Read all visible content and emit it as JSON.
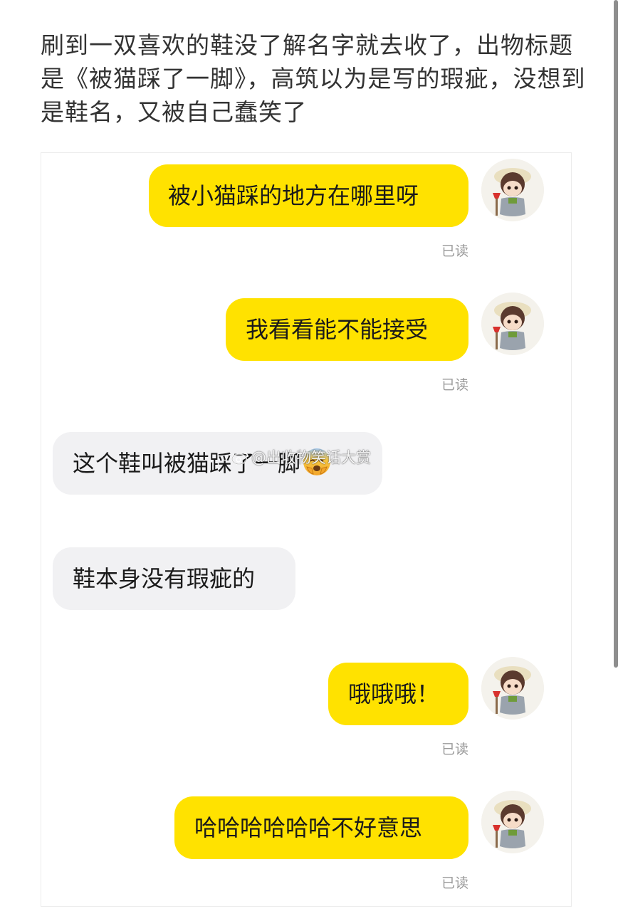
{
  "post": {
    "text": "刷到一双喜欢的鞋没了解名字就去收了，出物标题是《被猫踩了一脚》，高筑以为是写的瑕疵，没想到是鞋名，又被自己蠢笑了"
  },
  "chat": {
    "messages": [
      {
        "text": "被小猫踩的地方在哪里呀",
        "status": "已读"
      },
      {
        "text": "我看看能不能接受",
        "status": "已读"
      },
      {
        "text": "这个鞋叫被猫踩了一脚"
      },
      {
        "text": "鞋本身没有瑕疵的"
      },
      {
        "text": "哦哦哦！",
        "status": "已读"
      },
      {
        "text": "哈哈哈哈哈哈不好意思",
        "status": "已读"
      }
    ],
    "emoji": "cold-sweat-emoji"
  },
  "watermark": {
    "text": "@出收物笑话大赏"
  },
  "colors": {
    "outgoing_bubble": "#ffe200",
    "incoming_bubble": "#f1f1f3",
    "read_status": "#9a9a9a"
  }
}
